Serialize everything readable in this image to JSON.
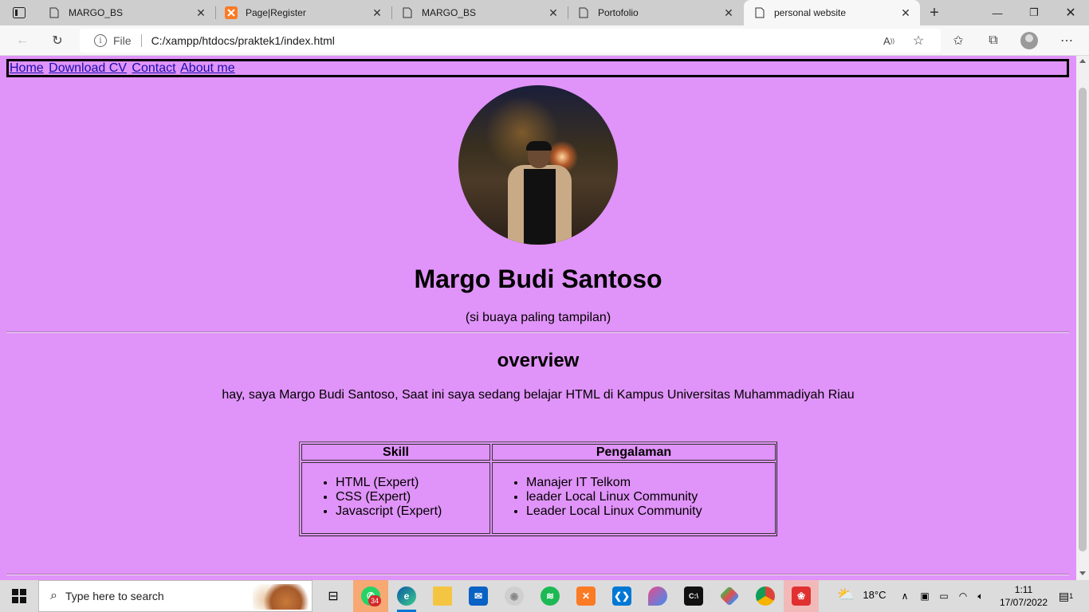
{
  "browser": {
    "tabs": [
      {
        "title": "MARGO_BS",
        "icon": "page-icon"
      },
      {
        "title": "Page|Register",
        "icon": "xampp-icon"
      },
      {
        "title": "MARGO_BS",
        "icon": "page-icon"
      },
      {
        "title": "Portofolio",
        "icon": "page-icon"
      },
      {
        "title": "personal website",
        "icon": "page-icon",
        "active": true
      }
    ],
    "address_prefix": "File",
    "url": "C:/xampp/htdocs/praktek1/index.html"
  },
  "page": {
    "nav": [
      "Home",
      "Download CV",
      "Contact",
      "About me"
    ],
    "name": "Margo Budi Santoso",
    "tagline": "(si buaya paling tampilan)",
    "overview_heading": "overview",
    "overview_text": "hay, saya Margo Budi Santoso, Saat ini saya sedang belajar HTML di Kampus Universitas Muhammadiyah Riau",
    "table": {
      "headers": [
        "Skill",
        "Pengalaman"
      ],
      "skills": [
        "HTML (Expert)",
        "CSS (Expert)",
        "Javascript (Expert)"
      ],
      "experience": [
        "Manajer IT Telkom",
        "leader Local Linux Community",
        "Leader Local Linux Community"
      ]
    },
    "background_color": "#e093f8"
  },
  "taskbar": {
    "search_placeholder": "Type here to search",
    "whatsapp_badge": "34",
    "temperature": "18°C",
    "time": "1:11",
    "date": "17/07/2022",
    "notification_count": "1"
  }
}
